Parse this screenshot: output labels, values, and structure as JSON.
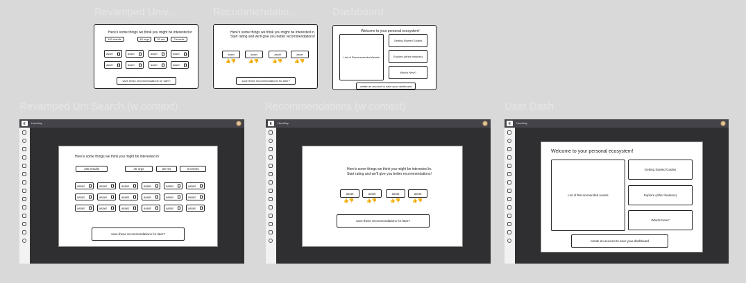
{
  "frames": {
    "small": [
      {
        "title": "Revamped Univ..."
      },
      {
        "title": "Recommendatio..."
      },
      {
        "title": "Dashboard"
      }
    ],
    "large": [
      {
        "title": "Revamped Uni Search (w context)"
      },
      {
        "title": "Recommendations (w context)"
      },
      {
        "title": "User Dash"
      }
    ]
  },
  "search": {
    "heading": "Here's some things we think you might be interested in",
    "filters": [
      "100 results",
      "40 orgs",
      "20 res",
      "3 events"
    ],
    "asset_label": "asset",
    "save_label": "save these recommendations for later?"
  },
  "recs": {
    "heading_line1": "Here's some things we think you might be interested in.",
    "heading_line2": "Start rating and we'll give you better recommendations!",
    "asset_label": "asset",
    "thumbs": "👍👎",
    "save_label": "save these recommendations for later?"
  },
  "dash": {
    "heading": "Welcome to your personal ecosystem!",
    "list_label": "List of Recommended Assets",
    "getting_started": "Getting Started Guides",
    "explore": "Explore (other features)",
    "whats_new": "What's New?",
    "create_account": "create an account to save your dashboard"
  },
  "app": {
    "brand": "HiveWay"
  },
  "colors": {
    "background": "#d9d9d9",
    "app_dark": "#2f2f31",
    "topbar": "#45434a",
    "thumbs": "#e0b400"
  }
}
